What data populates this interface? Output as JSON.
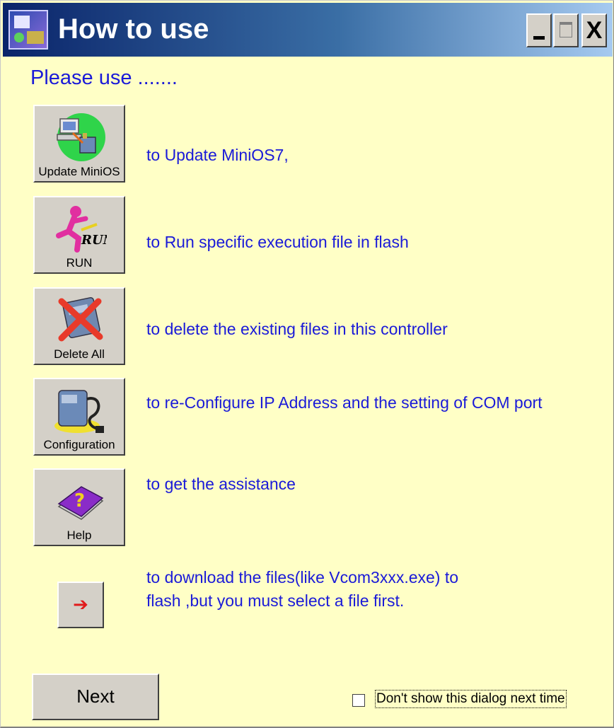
{
  "window": {
    "title": "How to use",
    "minimize_icon": "minimize-icon",
    "maximize_icon": "maximize-icon",
    "close_label": "X"
  },
  "heading": "Please use .......",
  "tools": [
    {
      "label": "Update MiniOS",
      "icon": "update-minios-icon",
      "description": "to Update MiniOS7,"
    },
    {
      "label": "RUN",
      "icon": "run-icon",
      "description": "to Run specific execution file in  flash"
    },
    {
      "label": "Delete All",
      "icon": "delete-all-icon",
      "description": "to delete the existing files in this controller"
    },
    {
      "label": "Configuration",
      "icon": "configuration-icon",
      "description": "to re-Configure IP Address and the setting of COM port"
    },
    {
      "label": "Help",
      "icon": "help-book-icon",
      "description": "to get the assistance"
    }
  ],
  "download": {
    "icon": "red-arrow-icon",
    "arrow_glyph": "➔",
    "description_line1": "to download the files(like Vcom3xxx.exe) to",
    "description_line2": "flash  ,but you must select a file first."
  },
  "footer": {
    "next_label": "Next",
    "dont_show_label": "Don't show this dialog next time",
    "dont_show_checked": false
  },
  "colors": {
    "background": "#ffffc6",
    "text_blue": "#1a1ad8",
    "titlebar_start": "#0a246a",
    "titlebar_end": "#a6caf0",
    "arrow_red": "#e11b1b"
  }
}
